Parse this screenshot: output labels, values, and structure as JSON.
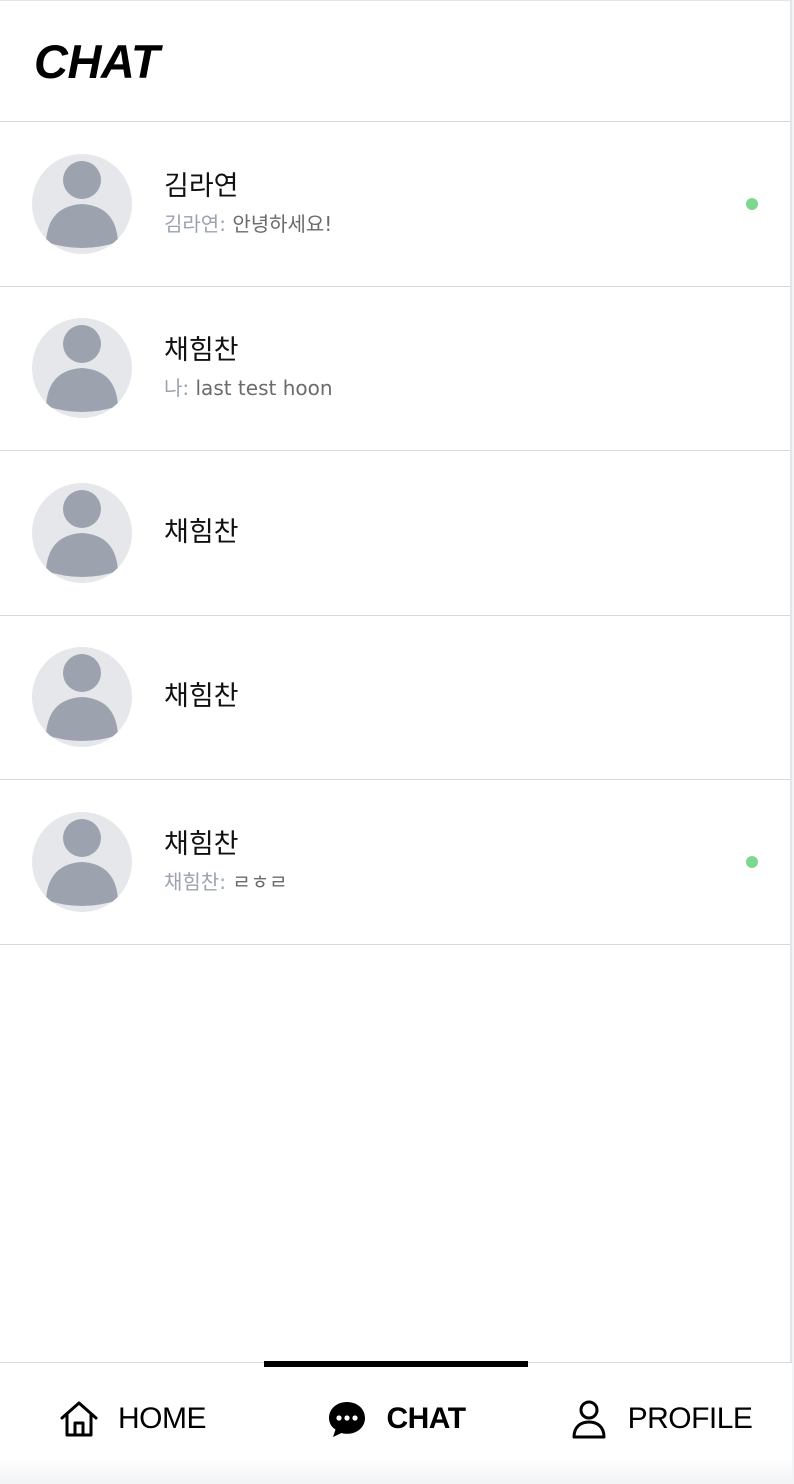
{
  "header": {
    "title": "CHAT"
  },
  "chats": [
    {
      "name": "김라연",
      "sender": "김라연:",
      "message": "안녕하세요!",
      "online": true
    },
    {
      "name": "채힘찬",
      "sender": "나:",
      "message": "last test hoon",
      "online": false
    },
    {
      "name": "채힘찬",
      "sender": "",
      "message": "",
      "online": false
    },
    {
      "name": "채힘찬",
      "sender": "",
      "message": "",
      "online": false
    },
    {
      "name": "채힘찬",
      "sender": "채힘찬:",
      "message": "ㄹㅎㄹ",
      "online": true
    }
  ],
  "nav": {
    "home_label": "HOME",
    "chat_label": "CHAT",
    "profile_label": "PROFILE",
    "active": "chat"
  },
  "colors": {
    "online": "#7bd88f",
    "avatar_bg": "#e5e7eb",
    "avatar_fg": "#9ca3af"
  }
}
